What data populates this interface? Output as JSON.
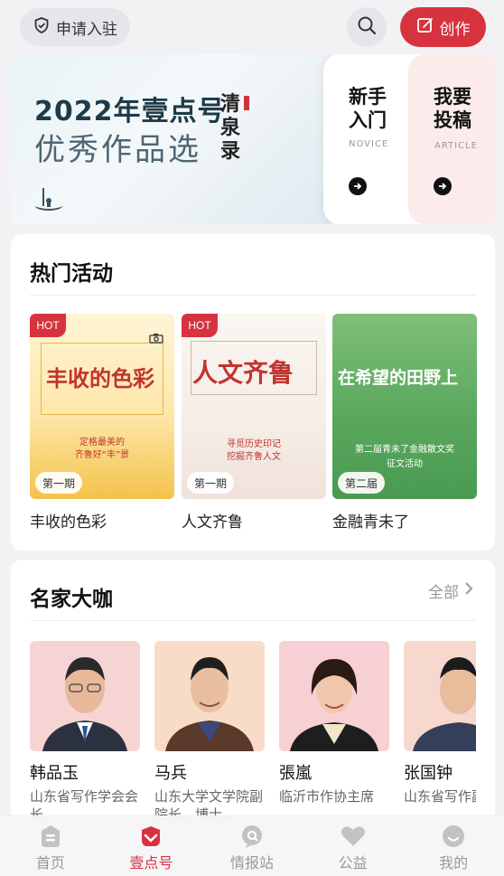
{
  "header": {
    "apply_label": "申请入驻",
    "create_label": "创作"
  },
  "banner": {
    "title_line1": "2022年壹点号",
    "title_line2": "优秀作品选",
    "brush_text": "清泉录",
    "cards": [
      {
        "title": "新手入门",
        "line1": "新手",
        "line2": "入门",
        "subtitle": "NOVICE"
      },
      {
        "title": "我要投稿",
        "line1": "我要",
        "line2": "投稿",
        "subtitle": "ARTICLE"
      }
    ]
  },
  "activities": {
    "title": "热门活动",
    "items": [
      {
        "label": "丰收的色彩",
        "badge": "HOT",
        "issue": "第一期",
        "art_title": "丰收的色彩",
        "art_sub1": "定格最美的",
        "art_sub2": "齐鲁好“丰”景"
      },
      {
        "label": "人文齐鲁",
        "badge": "HOT",
        "issue": "第一期",
        "art_title": "人文齐鲁",
        "art_sub1": "寻觅历史印记",
        "art_sub2": "挖掘齐鲁人文"
      },
      {
        "label": "金融青未了",
        "badge": "",
        "issue": "第二届",
        "art_title": "在希望的田野上",
        "art_sub1": "第二届青未了金融散文奖",
        "art_sub2": "征文活动"
      }
    ]
  },
  "writers": {
    "title": "名家大咖",
    "more_label": "全部",
    "items": [
      {
        "name": "韩品玉",
        "title": "山东省写作学会会长"
      },
      {
        "name": "马兵",
        "title": "山东大学文学院副院长、博士…"
      },
      {
        "name": "張嵐",
        "title": "临沂市作协主席"
      },
      {
        "name": "张国钟",
        "title": "山东省写作副会长"
      }
    ]
  },
  "tabbar": {
    "items": [
      {
        "label": "首页",
        "icon": "home-icon",
        "active": false
      },
      {
        "label": "壹点号",
        "icon": "yidian-icon",
        "active": true
      },
      {
        "label": "情报站",
        "icon": "intel-icon",
        "active": false
      },
      {
        "label": "公益",
        "icon": "heart-icon",
        "active": false
      },
      {
        "label": "我的",
        "icon": "profile-icon",
        "active": false
      }
    ]
  },
  "colors": {
    "accent": "#d7333e",
    "background": "#f2f2f4"
  }
}
